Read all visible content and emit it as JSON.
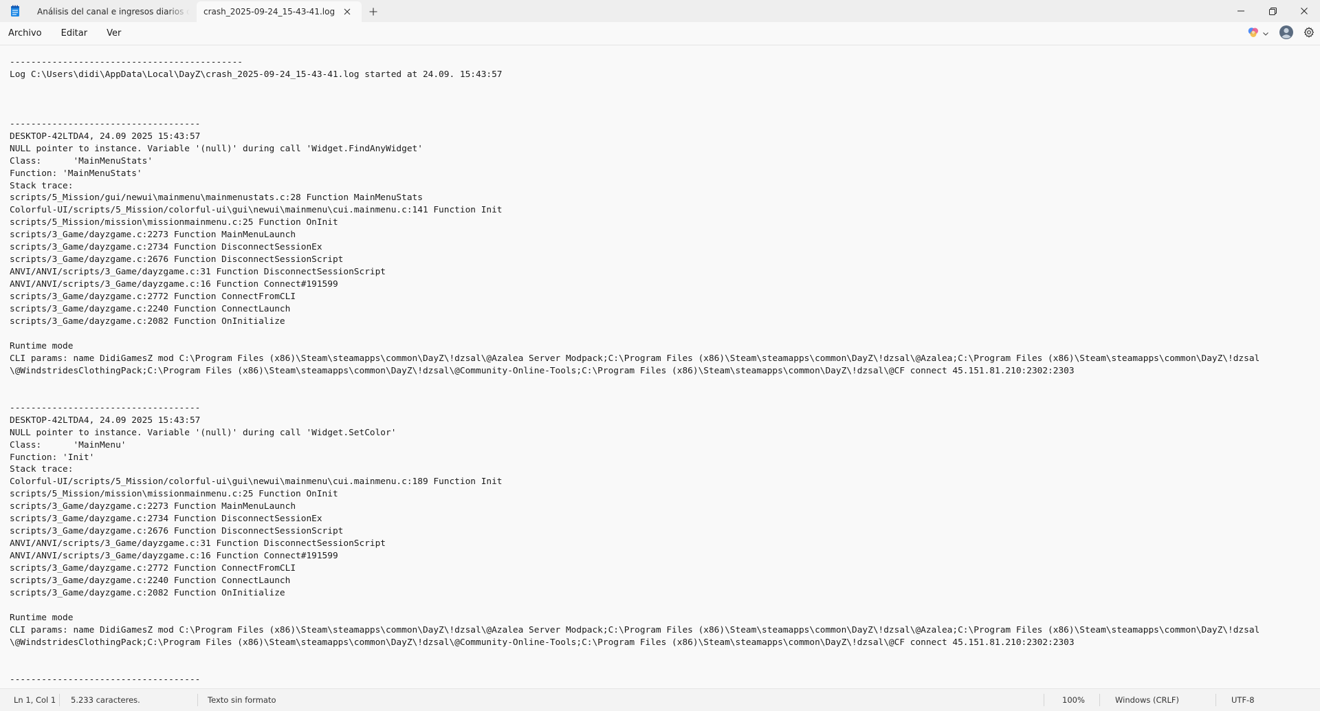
{
  "titlebar": {
    "tabs": [
      {
        "title": "Análisis del canal e ingresos diarios del Mes",
        "active": false
      },
      {
        "title": "crash_2025-09-24_15-43-41.log",
        "active": true
      }
    ],
    "icons": {
      "app": "notepad-icon",
      "close_tab": "close-icon",
      "new_tab": "plus-icon",
      "minimize": "minimize-icon",
      "maximize": "maximize-icon",
      "close_window": "close-icon"
    }
  },
  "menubar": {
    "items": [
      "Archivo",
      "Editar",
      "Ver"
    ],
    "icons": {
      "copilot": "copilot-icon",
      "dropdown": "chevron-down-icon",
      "account": "account-icon",
      "settings": "gear-icon"
    }
  },
  "editor": {
    "content": "--------------------------------------------\nLog C:\\Users\\didi\\AppData\\Local\\DayZ\\crash_2025-09-24_15-43-41.log started at 24.09. 15:43:57\n\n\n\n------------------------------------\nDESKTOP-42LTDA4, 24.09 2025 15:43:57\nNULL pointer to instance. Variable '(null)' during call 'Widget.FindAnyWidget'\nClass:      'MainMenuStats'\nFunction: 'MainMenuStats'\nStack trace:\nscripts/5_Mission/gui/newui\\mainmenu\\mainmenustats.c:28 Function MainMenuStats\nColorful-UI/scripts/5_Mission/colorful-ui\\gui\\newui\\mainmenu\\cui.mainmenu.c:141 Function Init\nscripts/5_Mission/mission\\missionmainmenu.c:25 Function OnInit\nscripts/3_Game/dayzgame.c:2273 Function MainMenuLaunch\nscripts/3_Game/dayzgame.c:2734 Function DisconnectSessionEx\nscripts/3_Game/dayzgame.c:2676 Function DisconnectSessionScript\nANVI/ANVI/scripts/3_Game/dayzgame.c:31 Function DisconnectSessionScript\nANVI/ANVI/scripts/3_Game/dayzgame.c:16 Function Connect#191599\nscripts/3_Game/dayzgame.c:2772 Function ConnectFromCLI\nscripts/3_Game/dayzgame.c:2240 Function ConnectLaunch\nscripts/3_Game/dayzgame.c:2082 Function OnInitialize\n\nRuntime mode\nCLI params: name DidiGamesZ mod C:\\Program Files (x86)\\Steam\\steamapps\\common\\DayZ\\!dzsal\\@Azalea Server Modpack;C:\\Program Files (x86)\\Steam\\steamapps\\common\\DayZ\\!dzsal\\@Azalea;C:\\Program Files (x86)\\Steam\\steamapps\\common\\DayZ\\!dzsal\n\\@WindstridesClothingPack;C:\\Program Files (x86)\\Steam\\steamapps\\common\\DayZ\\!dzsal\\@Community-Online-Tools;C:\\Program Files (x86)\\Steam\\steamapps\\common\\DayZ\\!dzsal\\@CF connect 45.151.81.210:2302:2303\n\n\n------------------------------------\nDESKTOP-42LTDA4, 24.09 2025 15:43:57\nNULL pointer to instance. Variable '(null)' during call 'Widget.SetColor'\nClass:      'MainMenu'\nFunction: 'Init'\nStack trace:\nColorful-UI/scripts/5_Mission/colorful-ui\\gui\\newui\\mainmenu\\cui.mainmenu.c:189 Function Init\nscripts/5_Mission/mission\\missionmainmenu.c:25 Function OnInit\nscripts/3_Game/dayzgame.c:2273 Function MainMenuLaunch\nscripts/3_Game/dayzgame.c:2734 Function DisconnectSessionEx\nscripts/3_Game/dayzgame.c:2676 Function DisconnectSessionScript\nANVI/ANVI/scripts/3_Game/dayzgame.c:31 Function DisconnectSessionScript\nANVI/ANVI/scripts/3_Game/dayzgame.c:16 Function Connect#191599\nscripts/3_Game/dayzgame.c:2772 Function ConnectFromCLI\nscripts/3_Game/dayzgame.c:2240 Function ConnectLaunch\nscripts/3_Game/dayzgame.c:2082 Function OnInitialize\n\nRuntime mode\nCLI params: name DidiGamesZ mod C:\\Program Files (x86)\\Steam\\steamapps\\common\\DayZ\\!dzsal\\@Azalea Server Modpack;C:\\Program Files (x86)\\Steam\\steamapps\\common\\DayZ\\!dzsal\\@Azalea;C:\\Program Files (x86)\\Steam\\steamapps\\common\\DayZ\\!dzsal\n\\@WindstridesClothingPack;C:\\Program Files (x86)\\Steam\\steamapps\\common\\DayZ\\!dzsal\\@Community-Online-Tools;C:\\Program Files (x86)\\Steam\\steamapps\\common\\DayZ\\!dzsal\\@CF connect 45.151.81.210:2302:2303\n\n\n------------------------------------"
  },
  "statusbar": {
    "position": "Ln 1, Col 1",
    "characters": "5.233 caracteres.",
    "format": "Texto sin formato",
    "zoom": "100%",
    "line_ending": "Windows (CRLF)",
    "encoding": "UTF-8"
  },
  "colors": {
    "titlebar_bg": "#eeeeee",
    "editor_bg": "#f9f9f9",
    "statusbar_bg": "#f3f3f3",
    "text": "#1a1a1a"
  }
}
